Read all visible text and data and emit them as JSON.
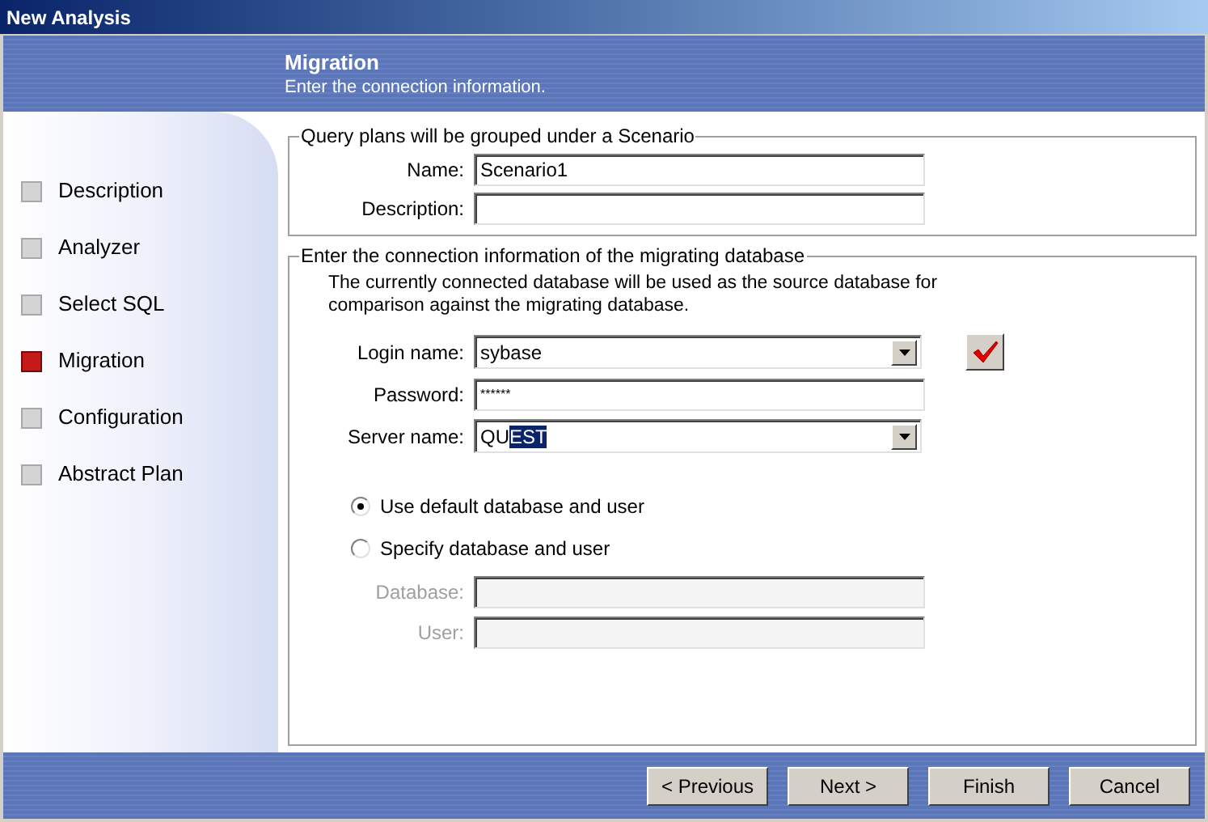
{
  "window": {
    "title": "New Analysis"
  },
  "header": {
    "title": "Migration",
    "subtitle": "Enter the connection information."
  },
  "steps": [
    {
      "label": "Description",
      "selected": false
    },
    {
      "label": "Analyzer",
      "selected": false
    },
    {
      "label": "Select SQL",
      "selected": false
    },
    {
      "label": "Migration",
      "selected": true
    },
    {
      "label": "Configuration",
      "selected": false
    },
    {
      "label": "Abstract Plan",
      "selected": false
    }
  ],
  "scenario_group": {
    "title": "Query plans will be grouped under a Scenario",
    "fields": [
      {
        "label": "Name:",
        "value": "Scenario1"
      },
      {
        "label": "Description:"
      }
    ]
  },
  "connection_group": {
    "title": "Enter the connection information of the migrating database",
    "note": "The currently connected database will be used as the source database for comparison against the migrating database.",
    "login": {
      "label": "Login name:",
      "value": "sybase"
    },
    "password": {
      "label": "Password:",
      "value": "******"
    },
    "server": {
      "label": "Server name:",
      "value": "QU",
      "selected_text": "EST"
    },
    "options": [
      {
        "label": "Use default database and user",
        "selected": true
      },
      {
        "label": "Specify database and user",
        "selected": false
      }
    ],
    "db_fields": [
      {
        "label": "Database:",
        "disabled": true
      },
      {
        "label": "User:",
        "disabled": true
      }
    ]
  },
  "buttons": [
    "< Previous",
    "Next >",
    "Finish",
    "Cancel"
  ]
}
